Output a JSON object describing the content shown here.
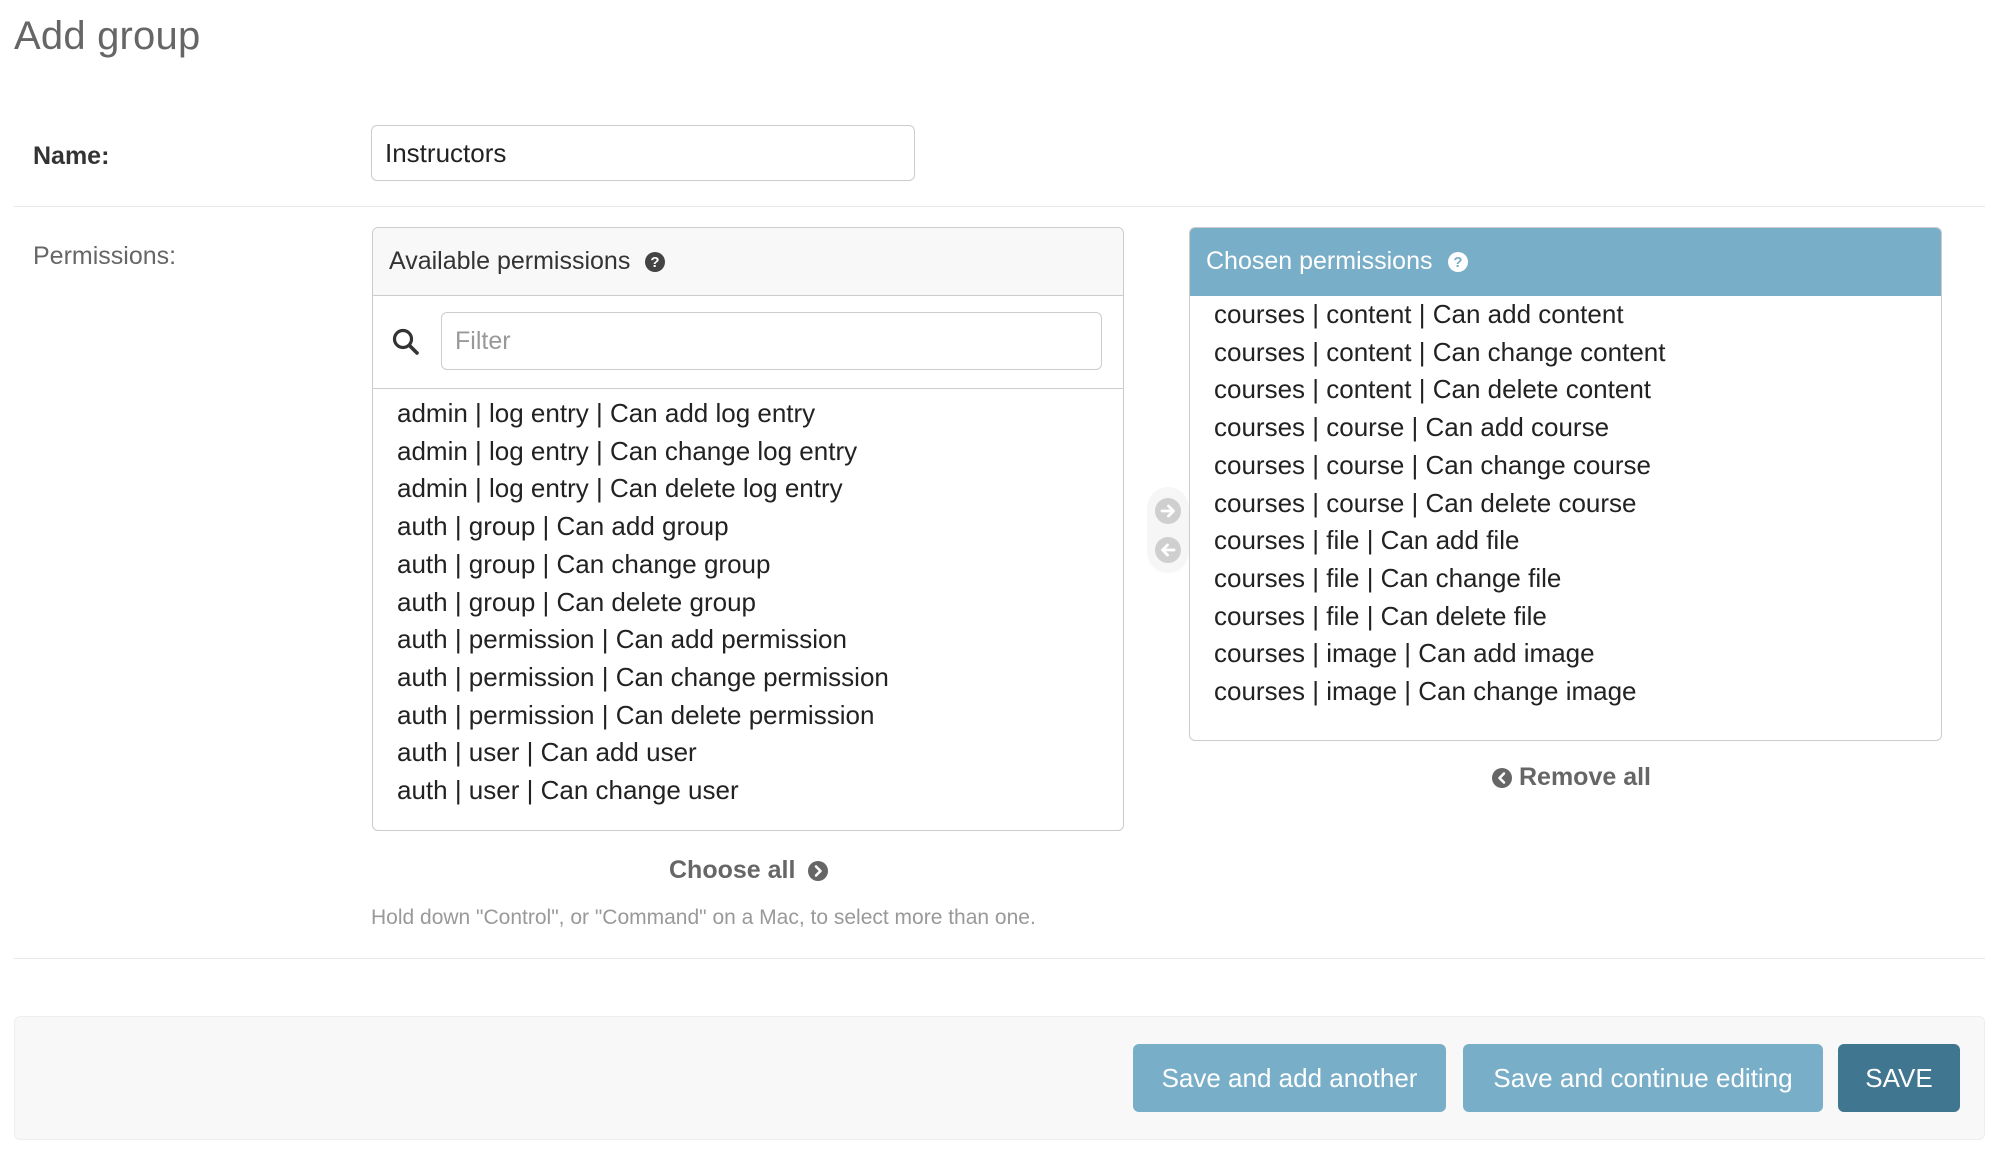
{
  "page": {
    "title": "Add group"
  },
  "name_field": {
    "label": "Name:",
    "value": "Instructors"
  },
  "permissions": {
    "label": "Permissions:",
    "available": {
      "title": "Available permissions",
      "filter_placeholder": "Filter",
      "items": [
        "admin | log entry | Can add log entry",
        "admin | log entry | Can change log entry",
        "admin | log entry | Can delete log entry",
        "auth | group | Can add group",
        "auth | group | Can change group",
        "auth | group | Can delete group",
        "auth | permission | Can add permission",
        "auth | permission | Can change permission",
        "auth | permission | Can delete permission",
        "auth | user | Can add user",
        "auth | user | Can change user"
      ],
      "choose_all_label": "Choose all"
    },
    "chosen": {
      "title": "Chosen permissions",
      "items": [
        "courses | content | Can add content",
        "courses | content | Can change content",
        "courses | content | Can delete content",
        "courses | course | Can add course",
        "courses | course | Can change course",
        "courses | course | Can delete course",
        "courses | file | Can add file",
        "courses | file | Can change file",
        "courses | file | Can delete file",
        "courses | image | Can add image",
        "courses | image | Can change image"
      ],
      "remove_all_label": "Remove all"
    },
    "help_text": "Hold down \"Control\", or \"Command\" on a Mac, to select more than one."
  },
  "submit_row": {
    "save_add_another_label": "Save and add another",
    "save_continue_label": "Save and continue editing",
    "save_label": "SAVE"
  },
  "colors": {
    "accent": "#79aec8",
    "primary_button": "#417690",
    "label_text": "#333333",
    "muted_text": "#999999"
  },
  "icons": {
    "help": "question-circle-icon",
    "search": "magnifier-icon",
    "add_arrow": "arrow-right-circle-icon",
    "remove_arrow": "arrow-left-circle-icon",
    "choose_all": "chevron-right-circle-icon",
    "remove_all": "chevron-left-circle-icon"
  }
}
